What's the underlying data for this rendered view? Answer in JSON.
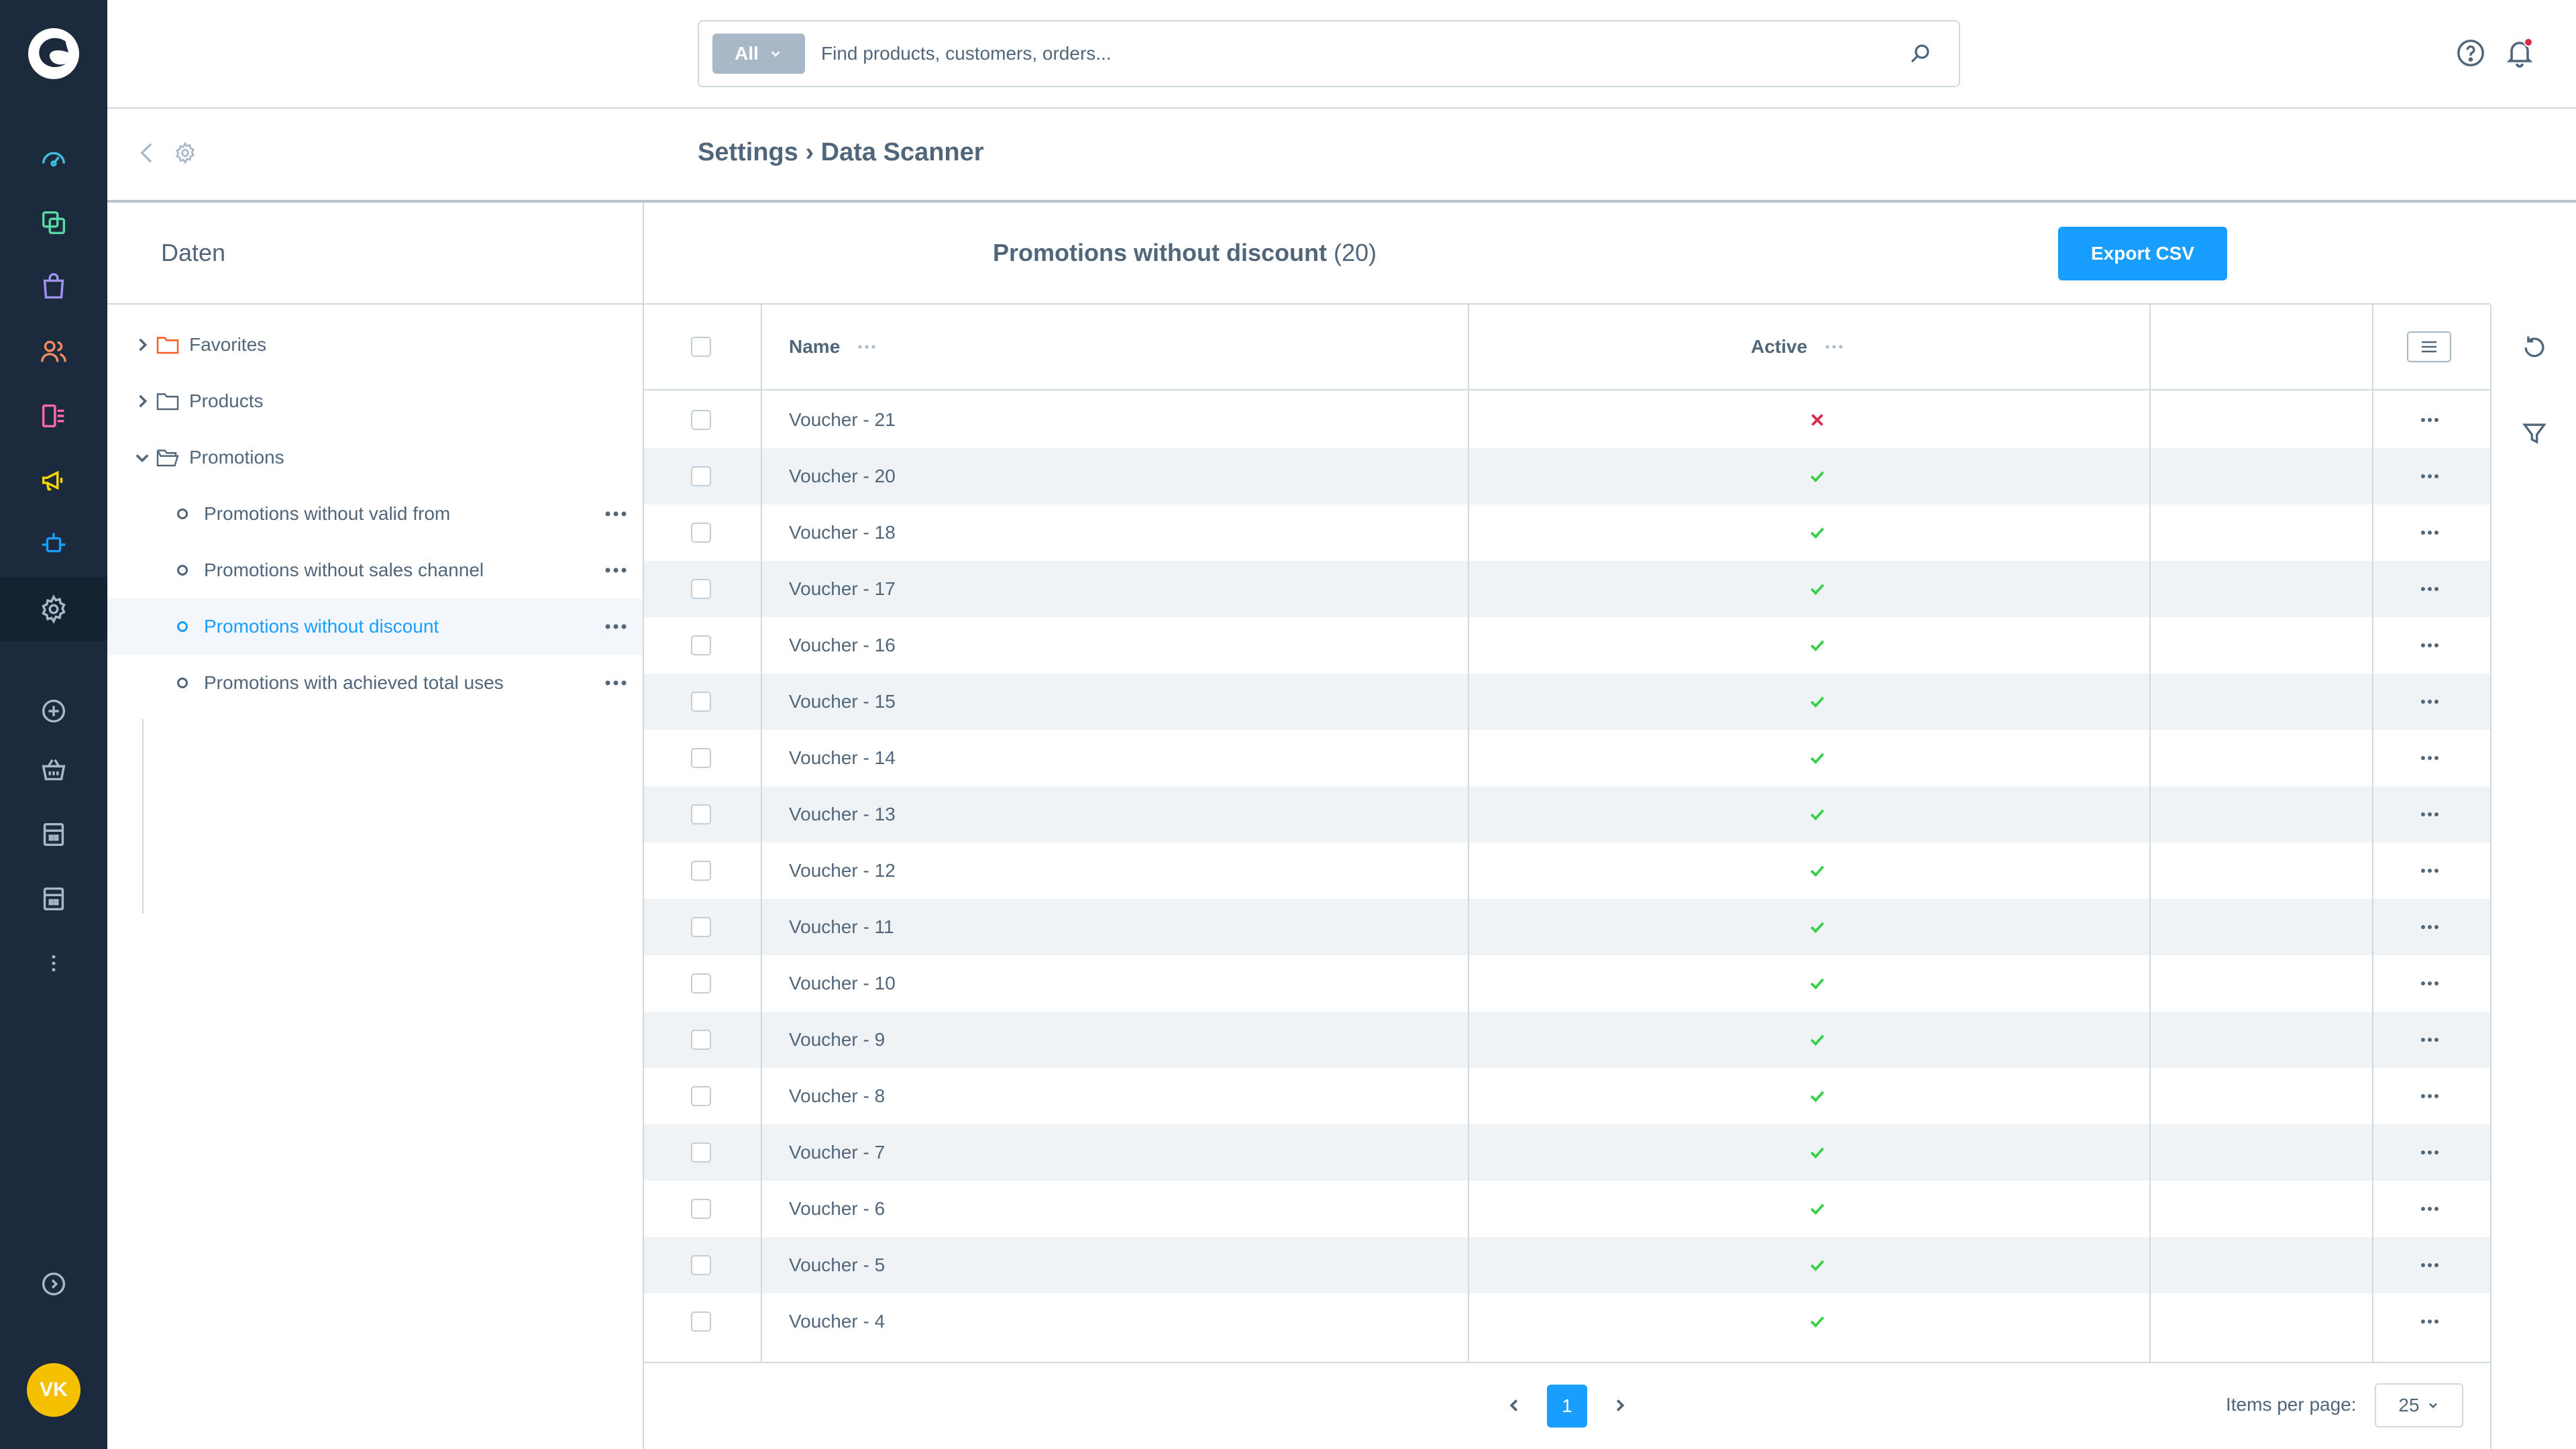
{
  "nav": {
    "avatar_initials": "VK",
    "icons": [
      "dashboard-icon",
      "catalogue-icon",
      "orders-icon",
      "customers-icon",
      "content-icon",
      "marketing-icon",
      "extensions-icon",
      "settings-icon",
      "add-sales-channel-icon",
      "storefront-icon",
      "sales-channel-icon",
      "sales-channel-icon",
      "more-icon",
      "expand-icon"
    ]
  },
  "search": {
    "type_label": "All",
    "placeholder": "Find products, customers, orders..."
  },
  "header": {
    "breadcrumb": "Settings › Data Scanner"
  },
  "left_panel": {
    "title": "Daten",
    "tree": [
      {
        "label": "Favorites",
        "kind": "folder",
        "expanded": false,
        "color": "#ff5722"
      },
      {
        "label": "Products",
        "kind": "folder",
        "expanded": false
      },
      {
        "label": "Promotions",
        "kind": "folder",
        "expanded": true
      },
      {
        "label": "Promotions without valid from",
        "kind": "item"
      },
      {
        "label": "Promotions without sales channel",
        "kind": "item"
      },
      {
        "label": "Promotions without discount",
        "kind": "item",
        "selected": true
      },
      {
        "label": "Promotions with achieved total uses",
        "kind": "item"
      }
    ]
  },
  "grid": {
    "title": "Promotions without discount",
    "count": "(20)",
    "export_label": "Export CSV",
    "columns": {
      "name": "Name",
      "active": "Active"
    },
    "rows": [
      {
        "name": "Voucher - 21",
        "active": false
      },
      {
        "name": "Voucher - 20",
        "active": true
      },
      {
        "name": "Voucher - 18",
        "active": true
      },
      {
        "name": "Voucher - 17",
        "active": true
      },
      {
        "name": "Voucher - 16",
        "active": true
      },
      {
        "name": "Voucher - 15",
        "active": true
      },
      {
        "name": "Voucher - 14",
        "active": true
      },
      {
        "name": "Voucher - 13",
        "active": true
      },
      {
        "name": "Voucher - 12",
        "active": true
      },
      {
        "name": "Voucher - 11",
        "active": true
      },
      {
        "name": "Voucher - 10",
        "active": true
      },
      {
        "name": "Voucher - 9",
        "active": true
      },
      {
        "name": "Voucher - 8",
        "active": true
      },
      {
        "name": "Voucher - 7",
        "active": true
      },
      {
        "name": "Voucher - 6",
        "active": true
      },
      {
        "name": "Voucher - 5",
        "active": true
      },
      {
        "name": "Voucher - 4",
        "active": true
      }
    ]
  },
  "pagination": {
    "current_page": "1",
    "items_per_page_label": "Items per page:",
    "items_per_page": "25"
  },
  "colors": {
    "nav_bg": "#1b2a3c",
    "accent": "#189eff",
    "check": "#37d046",
    "cross": "#de294c",
    "avatar": "#f5c000"
  }
}
